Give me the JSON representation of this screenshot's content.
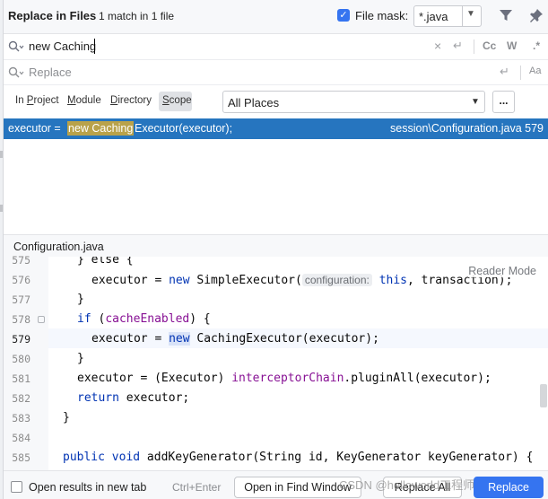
{
  "header": {
    "title": "Replace in Files",
    "match_info": "1 match in 1 file",
    "file_mask_label": "File mask:",
    "file_mask_checked": true,
    "file_mask_value": "*.java",
    "icons": [
      "filter-icon",
      "pin-icon"
    ]
  },
  "search": {
    "value": "new Caching",
    "options": {
      "match_case": "Cc",
      "words": "W",
      "regex": ".*"
    }
  },
  "replace": {
    "placeholder": "Replace",
    "preserve_case": "Aa"
  },
  "scope": {
    "tabs": [
      {
        "pre": "In ",
        "ul": "P",
        "post": "roject"
      },
      {
        "pre": "",
        "ul": "M",
        "post": "odule"
      },
      {
        "pre": "",
        "ul": "D",
        "post": "irectory"
      },
      {
        "pre": "",
        "ul": "S",
        "post": "cope"
      }
    ],
    "selected": "Scope",
    "places_value": "All Places",
    "more_label": "..."
  },
  "results": [
    {
      "prefix": "executor = ",
      "highlight": "new Caching",
      "suffix": "Executor(executor);",
      "path": "session\\Configuration.java 579"
    }
  ],
  "preview": {
    "file_name": "Configuration.java",
    "reader_mode": "Reader Mode",
    "current_line": "579",
    "line_numbers": [
      "575",
      "576",
      "577",
      "578",
      "579",
      "580",
      "581",
      "582",
      "583",
      "584",
      "585"
    ],
    "code": {
      "l575": "} else {",
      "l576_a": "executor = ",
      "l576_kw": "new",
      "l576_b": " SimpleExecutor(",
      "l576_hint": "configuration:",
      "l576_kw2": "this",
      "l576_c": ", transaction);",
      "l577": "}",
      "l578_kw": "if",
      "l578_a": " (",
      "l578_fn": "cacheEnabled",
      "l578_b": ") {",
      "l579_a": "executor = ",
      "l579_kw": "new",
      "l579_b": " CachingExecutor(executor);",
      "l580": "}",
      "l581_a": "executor = (Executor) ",
      "l581_fn": "interceptorChain",
      "l581_b": ".pluginAll(executor);",
      "l582_kw": "return",
      "l582_a": " executor;",
      "l583": "}",
      "l585_kw1": "public",
      "l585_kw2": "void",
      "l585_a": " addKeyGenerator(String id, KeyGenerator keyGenerator) {"
    }
  },
  "bottom": {
    "new_tab_label": "Open results in new tab",
    "new_tab_checked": false,
    "shortcut": "Ctrl+Enter",
    "open_find_window": "Open in Find Window",
    "replace_all": "Replace All",
    "replace": "Replace",
    "watermark": "CSDN @helloworld工程师"
  }
}
